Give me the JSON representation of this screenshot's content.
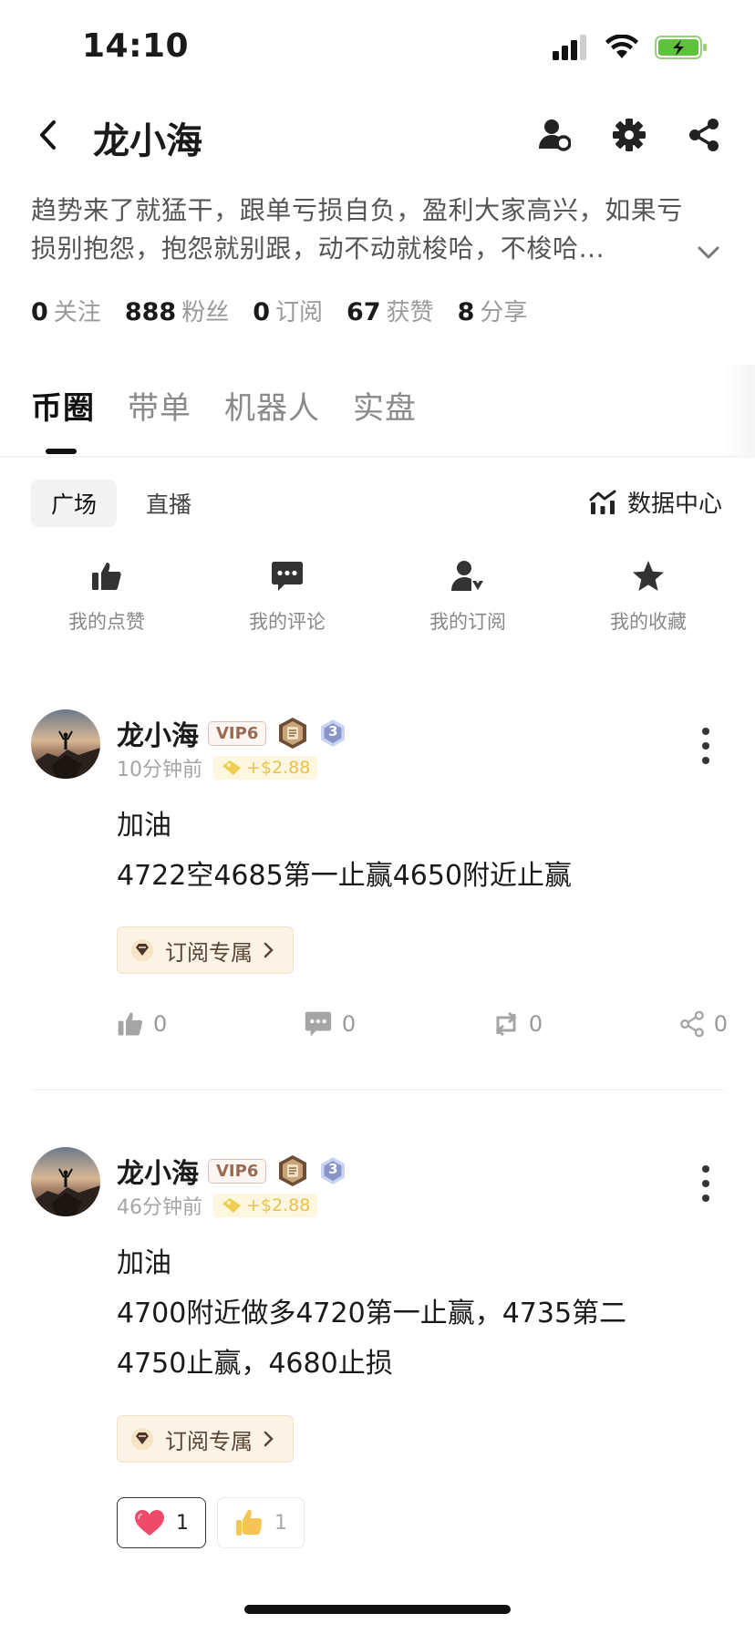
{
  "status_bar": {
    "time": "14:10"
  },
  "nav": {
    "title": "龙小海"
  },
  "profile": {
    "bio_line1": "趋势来了就猛干，跟单亏损自负，盈利大家高兴，如果亏",
    "bio_line2": "损别抱怨，抱怨就别跟，动不动就梭哈，不梭哈...",
    "stats": [
      {
        "value": "0",
        "label": "关注"
      },
      {
        "value": "888",
        "label": "粉丝"
      },
      {
        "value": "0",
        "label": "订阅"
      },
      {
        "value": "67",
        "label": "获赞"
      },
      {
        "value": "8",
        "label": "分享"
      }
    ]
  },
  "main_tabs": [
    "币圈",
    "带单",
    "机器人",
    "实盘"
  ],
  "sub_tabs": [
    "广场",
    "直播"
  ],
  "data_center_label": "数据中心",
  "quick_actions": [
    {
      "label": "我的点赞",
      "icon": "thumbs-up-icon"
    },
    {
      "label": "我的评论",
      "icon": "comment-icon"
    },
    {
      "label": "我的订阅",
      "icon": "subscribe-user-icon"
    },
    {
      "label": "我的收藏",
      "icon": "star-icon"
    }
  ],
  "posts": [
    {
      "author": "龙小海",
      "vip": "VIP6",
      "level": "3",
      "time": "10分钟前",
      "reward": "+$2.88",
      "lines": [
        "加油",
        "4722空4685第一止赢4650附近止赢"
      ],
      "tag": "订阅专属",
      "likes": "0",
      "comments": "0",
      "reposts": "0",
      "shares": "0"
    },
    {
      "author": "龙小海",
      "vip": "VIP6",
      "level": "3",
      "time": "46分钟前",
      "reward": "+$2.88",
      "lines": [
        "加油",
        "4700附近做多4720第一止赢，4735第二",
        "4750止赢，4680止损"
      ],
      "tag": "订阅专属",
      "reactions": [
        {
          "emoji": "heart",
          "count": "1"
        },
        {
          "emoji": "thumbs-up",
          "count": "1"
        }
      ]
    }
  ],
  "colors": {
    "accent": "#111111",
    "reward": "#e7c24d",
    "tag_bg": "#fbf3e5",
    "heart": "#f04a6a"
  }
}
